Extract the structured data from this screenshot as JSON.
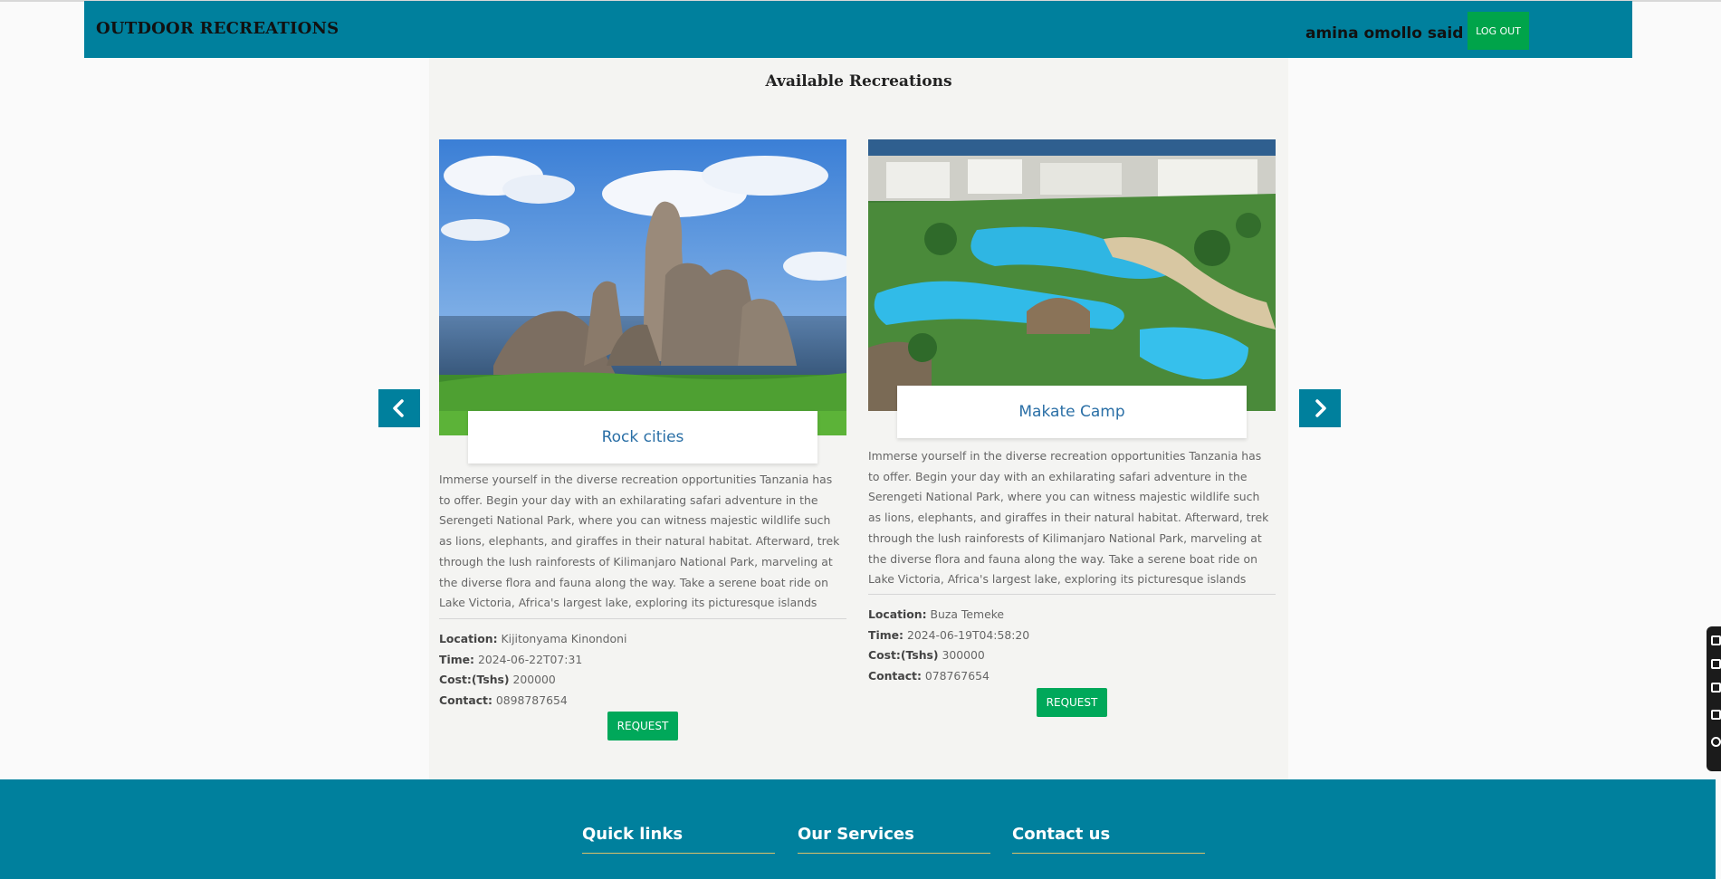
{
  "colors": {
    "brand": "#00809d",
    "accent": "#00a44a"
  },
  "header": {
    "title": "OUTDOOR RECREATIONS",
    "user_name": "amina omollo said",
    "logout_label": "LOG OUT"
  },
  "main": {
    "heading": "Available Recreations",
    "prev_icon": "chevron-left-icon",
    "next_icon": "chevron-right-icon",
    "cards": [
      {
        "name": "Rock cities",
        "description": "Immerse yourself in the diverse recreation opportunities Tanzania has to offer. Begin your day with an exhilarating safari adventure in the Serengeti National Park, where you can witness majestic wildlife such as lions, elephants, and giraffes in their natural habitat. Afterward, trek through the lush rainforests of Kilimanjaro National Park, marveling at the diverse flora and fauna along the way. Take a serene boat ride on Lake Victoria, Africa's largest lake, exploring its picturesque islands",
        "location_label": "Location:",
        "location": "Kijitonyama Kinondoni",
        "time_label": "Time:",
        "time": "2024-06-22T07:31",
        "cost_label": "Cost:(Tshs)",
        "cost": "200000",
        "contact_label": "Contact:",
        "contact": "0898787654",
        "request_label": "REQUEST"
      },
      {
        "name": "Makate Camp",
        "description": "Immerse yourself in the diverse recreation opportunities Tanzania has to offer. Begin your day with an exhilarating safari adventure in the Serengeti National Park, where you can witness majestic wildlife such as lions, elephants, and giraffes in their natural habitat. Afterward, trek through the lush rainforests of Kilimanjaro National Park, marveling at the diverse flora and fauna along the way. Take a serene boat ride on Lake Victoria, Africa's largest lake, exploring its picturesque islands",
        "location_label": "Location:",
        "location": "Buza Temeke",
        "time_label": "Time:",
        "time": "2024-06-19T04:58:20",
        "cost_label": "Cost:(Tshs)",
        "cost": "300000",
        "contact_label": "Contact:",
        "contact": "078767654",
        "request_label": "REQUEST"
      }
    ]
  },
  "footer": {
    "quick_links": "Quick links",
    "our_services": "Our Services",
    "contact_us": "Contact us"
  }
}
